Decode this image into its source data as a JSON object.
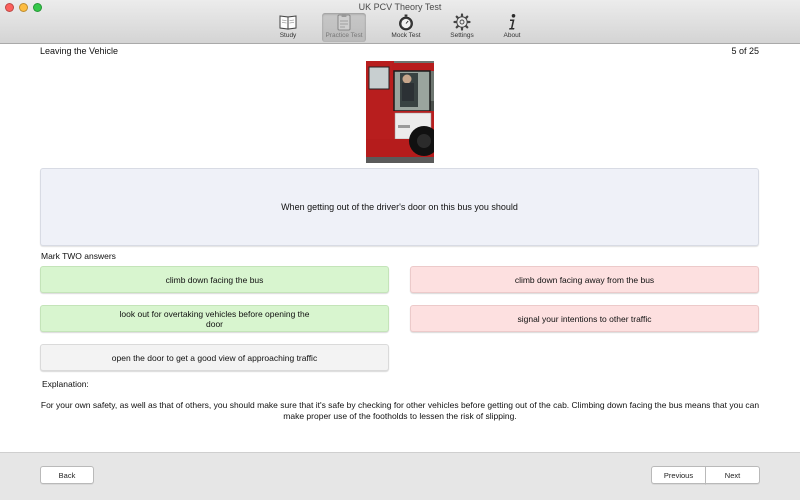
{
  "window": {
    "title": "UK PCV Theory Test"
  },
  "toolbar": {
    "items": [
      {
        "label": "Study",
        "icon": "book-icon"
      },
      {
        "label": "Practice Test",
        "icon": "clipboard-icon",
        "active": true
      },
      {
        "label": "Mock Test",
        "icon": "stopwatch-icon"
      },
      {
        "label": "Settings",
        "icon": "gear-icon"
      },
      {
        "label": "About",
        "icon": "info-icon"
      }
    ]
  },
  "question": {
    "section": "Leaving the Vehicle",
    "counter": "5 of 25",
    "image_icon": "bus-driver-door-photo",
    "text": "When getting out of the driver's door on this bus you should",
    "instruction": "Mark TWO answers"
  },
  "answers": [
    {
      "text": "climb down facing the bus",
      "state": "correct",
      "color": "#d8f5cf"
    },
    {
      "text": "climb down facing away from the bus",
      "state": "wrong",
      "color": "#fde0e0"
    },
    {
      "text": "look out for overtaking vehicles before opening the door",
      "state": "correct",
      "color": "#d8f5cf"
    },
    {
      "text": "signal your intentions to other traffic",
      "state": "wrong",
      "color": "#fde0e0"
    },
    {
      "text": "open the door to get a good view of approaching traffic",
      "state": "neutral",
      "color": "#f3f3f3"
    }
  ],
  "explanation": {
    "label": "Explanation:",
    "text": "For your own safety, as well as that of others, you should make sure that it's safe by checking for other vehicles before getting out of the cab. Climbing down facing the bus means that you can make proper use of the footholds to lessen the risk of slipping."
  },
  "navigation": {
    "back_label": "Back",
    "previous_label": "Previous",
    "next_label": "Next"
  }
}
